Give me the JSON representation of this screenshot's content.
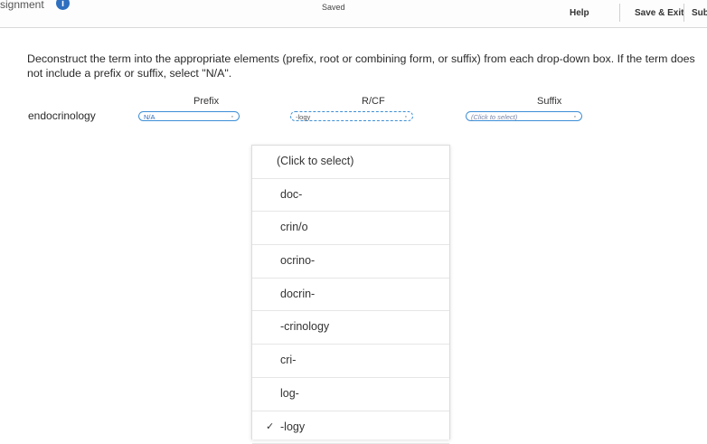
{
  "header": {
    "title": "signment",
    "info_icon": "i",
    "status": "Saved",
    "help": "Help",
    "save_exit": "Save & Exit",
    "submit": "Sub"
  },
  "instructions": "Deconstruct the term into the appropriate elements (prefix, root or combining form, or suffix) from each drop-down box. If the term does not include a prefix or suffix, select \"N/A\".",
  "columns": {
    "prefix": "Prefix",
    "root": "R/CF",
    "suffix": "Suffix"
  },
  "term": "endocrinology",
  "dropdowns": {
    "prefix_value": "N/A",
    "root_value": "-logy",
    "suffix_value": "(Click to select)",
    "chevron": "◦"
  },
  "menu": {
    "options": [
      "(Click to select)",
      "doc-",
      "crin/o",
      "ocrino-",
      "docrin-",
      "-crinology",
      "cri-",
      "log-",
      "-logy"
    ],
    "selected_index": 8,
    "check": "✓"
  }
}
